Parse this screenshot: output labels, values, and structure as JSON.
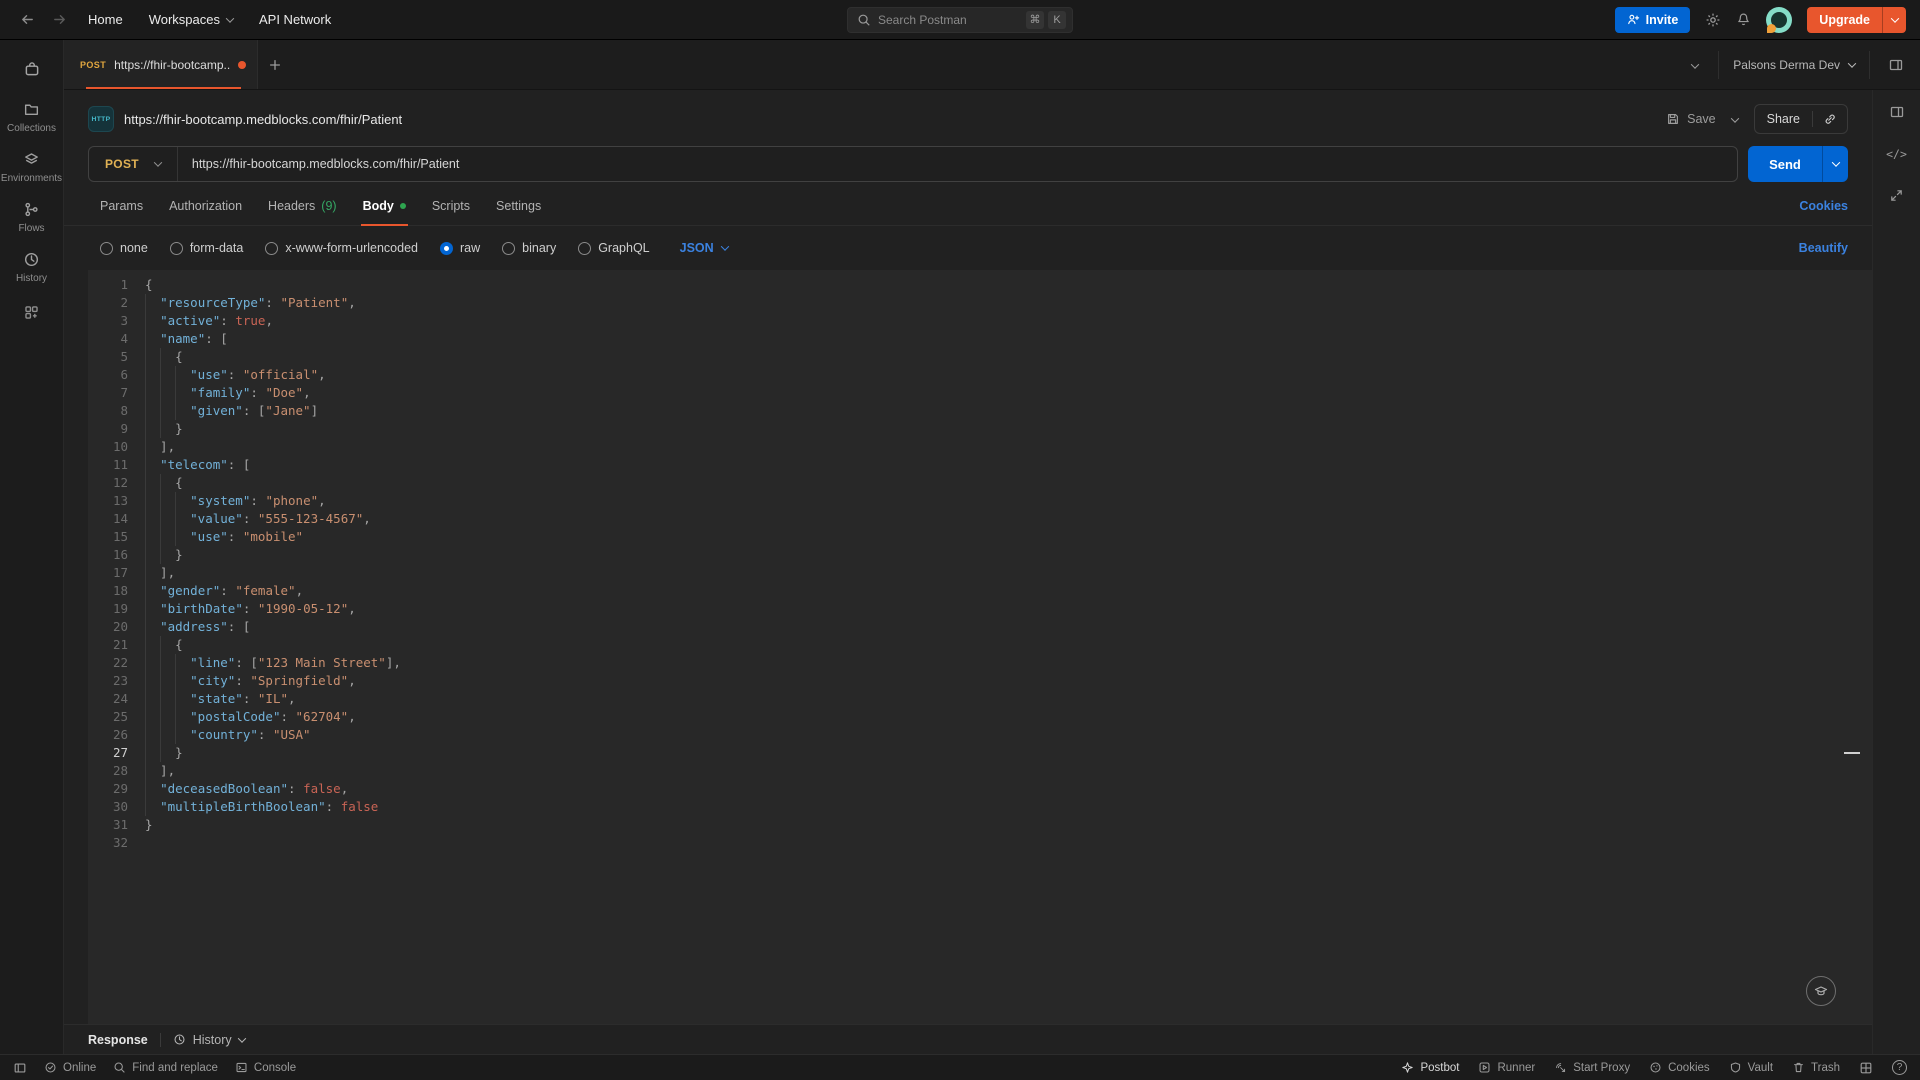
{
  "topbar": {
    "nav": {
      "home": "Home",
      "workspaces": "Workspaces",
      "api_network": "API Network"
    },
    "search": {
      "placeholder": "Search Postman",
      "key_cmd": "⌘",
      "key_k": "K"
    },
    "invite": "Invite",
    "upgrade": "Upgrade"
  },
  "tabstrip": {
    "method": "POST",
    "title": "https://fhir-bootcamp..",
    "workspace": "Palsons Derma Dev"
  },
  "request": {
    "badge": "HTTP",
    "title": "https://fhir-bootcamp.medblocks.com/fhir/Patient",
    "save": "Save",
    "share": "Share",
    "method": "POST",
    "url": "https://fhir-bootcamp.medblocks.com/fhir/Patient",
    "send": "Send",
    "cookies": "Cookies",
    "beautify": "Beautify",
    "language": "JSON",
    "tabs": [
      {
        "label": "Params"
      },
      {
        "label": "Authorization"
      },
      {
        "label": "Headers",
        "count": "(9)"
      },
      {
        "label": "Body"
      },
      {
        "label": "Scripts"
      },
      {
        "label": "Settings"
      }
    ],
    "body_types": [
      "none",
      "form-data",
      "x-www-form-urlencoded",
      "raw",
      "binary",
      "GraphQL"
    ]
  },
  "sidebar": {
    "items": [
      {
        "label": "Collections"
      },
      {
        "label": "Environments"
      },
      {
        "label": "Flows"
      },
      {
        "label": "History"
      }
    ]
  },
  "response_bar": {
    "response": "Response",
    "history": "History"
  },
  "statusbar": {
    "online": "Online",
    "find": "Find and replace",
    "console": "Console",
    "postbot": "Postbot",
    "runner": "Runner",
    "proxy": "Start Proxy",
    "cookies": "Cookies",
    "vault": "Vault",
    "trash": "Trash",
    "help": "?"
  },
  "icons": {
    "code_glyph": "</>"
  },
  "colors": {
    "accent_orange": "#e8562d",
    "post_yellow": "#e0a63f",
    "send_blue": "#0265d2",
    "link_blue": "#3b82e0",
    "success_green": "#2ea44f"
  },
  "editor": {
    "active_line": 27,
    "lines": [
      [
        [
          "p",
          "{"
        ]
      ],
      [
        [
          "p",
          "  "
        ],
        [
          "k",
          "\"resourceType\""
        ],
        [
          "p",
          ": "
        ],
        [
          "s",
          "\"Patient\""
        ],
        [
          "p",
          ","
        ]
      ],
      [
        [
          "p",
          "  "
        ],
        [
          "k",
          "\"active\""
        ],
        [
          "p",
          ": "
        ],
        [
          "b",
          "true"
        ],
        [
          "p",
          ","
        ]
      ],
      [
        [
          "p",
          "  "
        ],
        [
          "k",
          "\"name\""
        ],
        [
          "p",
          ": ["
        ]
      ],
      [
        [
          "p",
          "    {"
        ]
      ],
      [
        [
          "p",
          "      "
        ],
        [
          "k",
          "\"use\""
        ],
        [
          "p",
          ": "
        ],
        [
          "s",
          "\"official\""
        ],
        [
          "p",
          ","
        ]
      ],
      [
        [
          "p",
          "      "
        ],
        [
          "k",
          "\"family\""
        ],
        [
          "p",
          ": "
        ],
        [
          "s",
          "\"Doe\""
        ],
        [
          "p",
          ","
        ]
      ],
      [
        [
          "p",
          "      "
        ],
        [
          "k",
          "\"given\""
        ],
        [
          "p",
          ": ["
        ],
        [
          "s",
          "\"Jane\""
        ],
        [
          "p",
          "]"
        ]
      ],
      [
        [
          "p",
          "    }"
        ]
      ],
      [
        [
          "p",
          "  ],"
        ]
      ],
      [
        [
          "p",
          "  "
        ],
        [
          "k",
          "\"telecom\""
        ],
        [
          "p",
          ": ["
        ]
      ],
      [
        [
          "p",
          "    {"
        ]
      ],
      [
        [
          "p",
          "      "
        ],
        [
          "k",
          "\"system\""
        ],
        [
          "p",
          ": "
        ],
        [
          "s",
          "\"phone\""
        ],
        [
          "p",
          ","
        ]
      ],
      [
        [
          "p",
          "      "
        ],
        [
          "k",
          "\"value\""
        ],
        [
          "p",
          ": "
        ],
        [
          "s",
          "\"555-123-4567\""
        ],
        [
          "p",
          ","
        ]
      ],
      [
        [
          "p",
          "      "
        ],
        [
          "k",
          "\"use\""
        ],
        [
          "p",
          ": "
        ],
        [
          "s",
          "\"mobile\""
        ]
      ],
      [
        [
          "p",
          "    }"
        ]
      ],
      [
        [
          "p",
          "  ],"
        ]
      ],
      [
        [
          "p",
          "  "
        ],
        [
          "k",
          "\"gender\""
        ],
        [
          "p",
          ": "
        ],
        [
          "s",
          "\"female\""
        ],
        [
          "p",
          ","
        ]
      ],
      [
        [
          "p",
          "  "
        ],
        [
          "k",
          "\"birthDate\""
        ],
        [
          "p",
          ": "
        ],
        [
          "s",
          "\"1990-05-12\""
        ],
        [
          "p",
          ","
        ]
      ],
      [
        [
          "p",
          "  "
        ],
        [
          "k",
          "\"address\""
        ],
        [
          "p",
          ": ["
        ]
      ],
      [
        [
          "p",
          "    {"
        ]
      ],
      [
        [
          "p",
          "      "
        ],
        [
          "k",
          "\"line\""
        ],
        [
          "p",
          ": ["
        ],
        [
          "s",
          "\"123 Main Street\""
        ],
        [
          "p",
          "],"
        ]
      ],
      [
        [
          "p",
          "      "
        ],
        [
          "k",
          "\"city\""
        ],
        [
          "p",
          ": "
        ],
        [
          "s",
          "\"Springfield\""
        ],
        [
          "p",
          ","
        ]
      ],
      [
        [
          "p",
          "      "
        ],
        [
          "k",
          "\"state\""
        ],
        [
          "p",
          ": "
        ],
        [
          "s",
          "\"IL\""
        ],
        [
          "p",
          ","
        ]
      ],
      [
        [
          "p",
          "      "
        ],
        [
          "k",
          "\"postalCode\""
        ],
        [
          "p",
          ": "
        ],
        [
          "s",
          "\"62704\""
        ],
        [
          "p",
          ","
        ]
      ],
      [
        [
          "p",
          "      "
        ],
        [
          "k",
          "\"country\""
        ],
        [
          "p",
          ": "
        ],
        [
          "s",
          "\"USA\""
        ]
      ],
      [
        [
          "p",
          "    }"
        ]
      ],
      [
        [
          "p",
          "  ],"
        ]
      ],
      [
        [
          "p",
          "  "
        ],
        [
          "k",
          "\"deceasedBoolean\""
        ],
        [
          "p",
          ": "
        ],
        [
          "b",
          "false"
        ],
        [
          "p",
          ","
        ]
      ],
      [
        [
          "p",
          "  "
        ],
        [
          "k",
          "\"multipleBirthBoolean\""
        ],
        [
          "p",
          ": "
        ],
        [
          "b",
          "false"
        ]
      ],
      [
        [
          "p",
          "}"
        ]
      ],
      []
    ]
  }
}
